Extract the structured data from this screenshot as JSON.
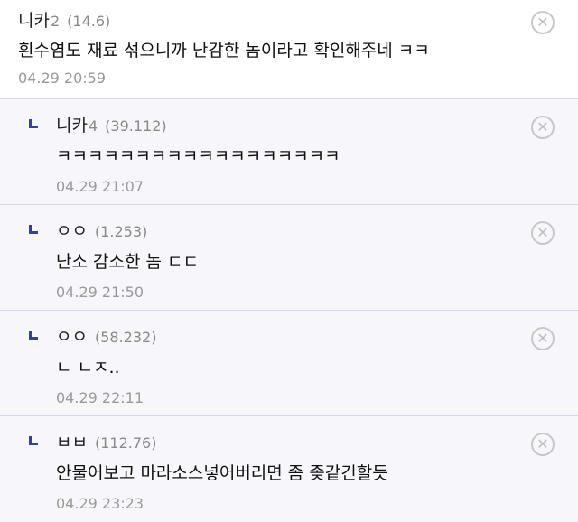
{
  "comments": [
    {
      "nick": "니카",
      "level": "2",
      "score": "(14.6)",
      "body": "흰수염도 재료 섞으니까 난감한 놈이라고 확인해주네 ㅋㅋ",
      "time": "04.29 20:59"
    },
    {
      "nick": "니카",
      "level": "4",
      "score": "(39.112)",
      "body": "ㅋㅋㅋㅋㅋㅋㅋㅋㅋㅋㅋㅋㅋㅋㅋㅋㅋㅋ",
      "time": "04.29 21:07"
    },
    {
      "nick": "ㅇㅇ",
      "level": "",
      "score": "(1.253)",
      "body": "난소 감소한 놈 ㄷㄷ",
      "time": "04.29 21:50"
    },
    {
      "nick": "ㅇㅇ",
      "level": "",
      "score": "(58.232)",
      "body": "ㄴ ㄴㅈ..",
      "time": "04.29 22:11"
    },
    {
      "nick": "ㅂㅂ",
      "level": "",
      "score": "(112.76)",
      "body": "안물어보고 마라소스넣어버리면 좀 좆같긴할듯",
      "time": "04.29 23:23"
    }
  ],
  "icons": {
    "delete": "close-circle-icon",
    "reply": "reply-arrow-icon"
  },
  "colors": {
    "reply_bg": "#f7f7fb",
    "reply_marker": "#3b3f8f",
    "divider": "#d9d9e6",
    "meta": "#8a8a8a"
  },
  "glyphs": {
    "delete": "✕"
  }
}
